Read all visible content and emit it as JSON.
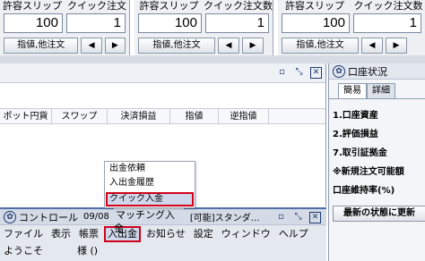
{
  "order_panels": [
    {
      "headers": [
        "許容スリップ",
        "クイック注文数"
      ],
      "slip": "100",
      "qty": "1",
      "order_button": "指値,他注文",
      "prev": "◀",
      "next": "▶"
    },
    {
      "headers": [
        "許容スリップ",
        "クイック注文数"
      ],
      "slip": "100",
      "qty": "1",
      "order_button": "指値,他注文",
      "prev": "◀",
      "next": "▶"
    },
    {
      "headers": [
        "許容スリップ",
        "クイック注文数"
      ],
      "slip": "100",
      "qty": "1",
      "order_button": "指値,他注文",
      "prev": "◀",
      "next": "▶"
    }
  ],
  "positions": {
    "columns": [
      "ポット円貨",
      "スワップ",
      "決済損益",
      "指値",
      "逆指値"
    ]
  },
  "account": {
    "title": "口座状況",
    "tabs": [
      "簡易",
      "詳細"
    ],
    "rows": [
      "1.口座資産",
      "2.評価損益",
      "7.取引証拠金",
      "※新規注文可能額",
      "口座維持率(%)"
    ],
    "refresh": "最新の状態に更新"
  },
  "dropdown": {
    "items": [
      "出金依頼",
      "入出金履歴",
      "クイック入金"
    ]
  },
  "control": {
    "title": "コントロール",
    "date": "09/08",
    "tooltip": "マッチング入金",
    "rest": "[可能]スタンダ…",
    "menu": [
      "ファイル",
      "表示",
      "帳票",
      "入出金",
      "お知らせ",
      "設定",
      "ウィンドウ",
      "ヘルプ"
    ],
    "user_prefix": "ようこそ",
    "user_suffix": "様 ()"
  }
}
